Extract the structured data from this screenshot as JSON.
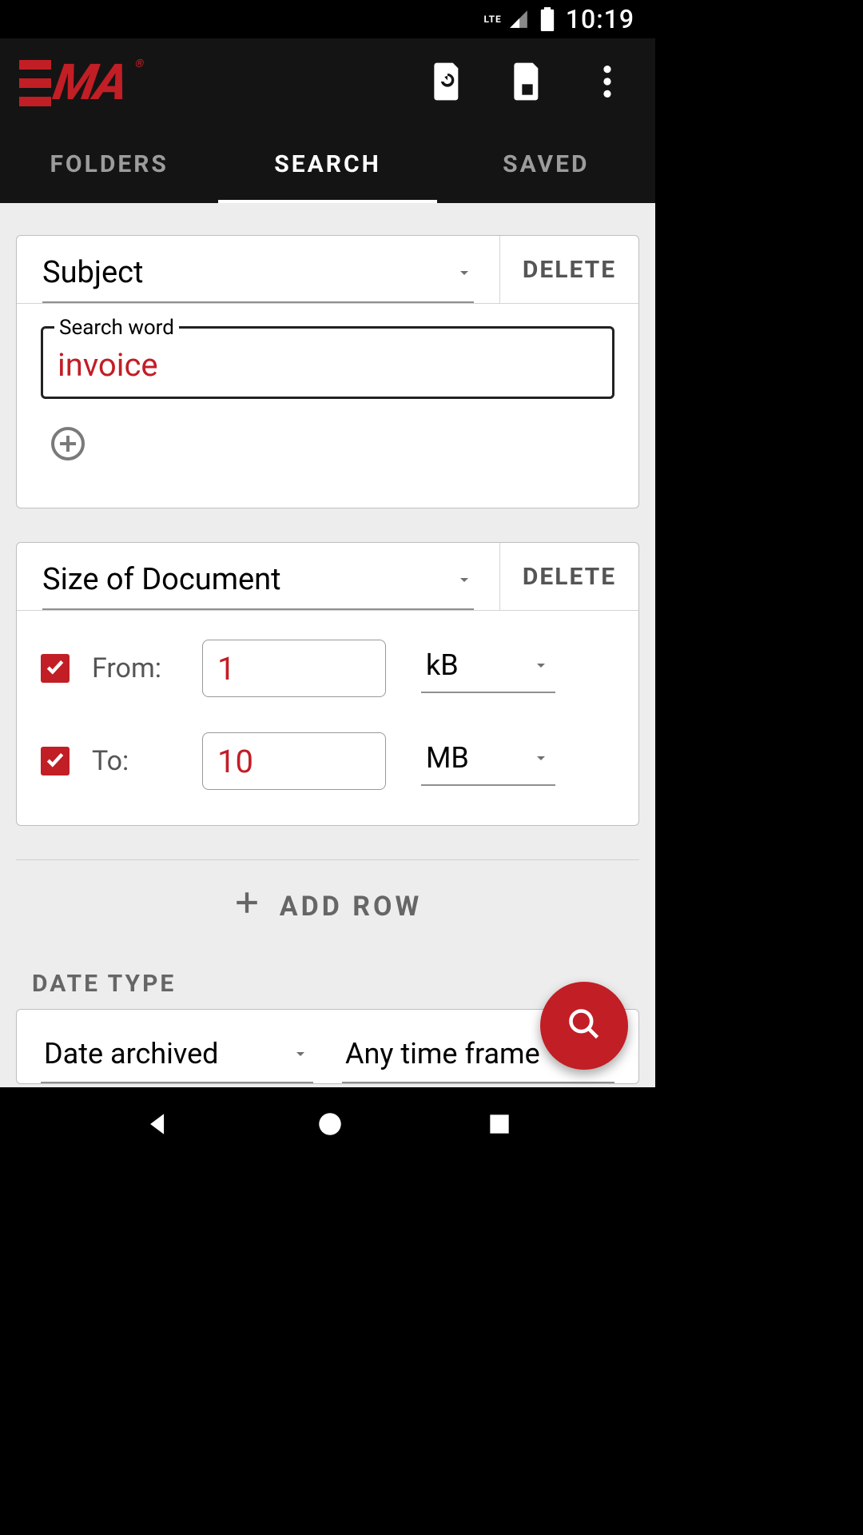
{
  "status": {
    "network": "LTE",
    "time": "10:19"
  },
  "appbar": {
    "logo_text": "MA",
    "logo_reg": "®"
  },
  "tabs": {
    "folders": "FOLDERS",
    "search": "SEARCH",
    "saved": "SAVED"
  },
  "buttons": {
    "delete": "DELETE",
    "add_row": "ADD ROW"
  },
  "criteria1": {
    "field": "Subject",
    "input_label": "Search word",
    "input_value": "invoice"
  },
  "criteria2": {
    "field": "Size of Document",
    "from_label": "From:",
    "from_value": "1",
    "from_unit": "kB",
    "to_label": "To:",
    "to_value": "10",
    "to_unit": "MB"
  },
  "date": {
    "section": "DATE TYPE",
    "type": "Date archived",
    "range": "Any time frame"
  },
  "colors": {
    "accent": "#c21e25"
  }
}
